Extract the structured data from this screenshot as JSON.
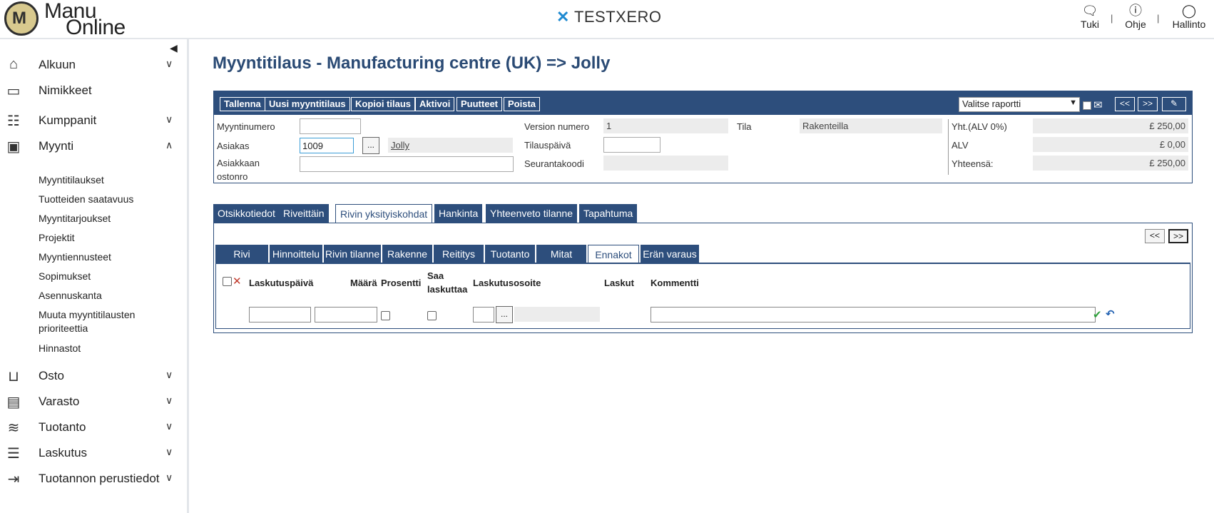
{
  "brand": {
    "line1": "Manu",
    "line2": "Online",
    "mark": "M"
  },
  "company": {
    "icon": "x-logo-icon",
    "name": "TESTXERO"
  },
  "topnav": [
    {
      "label": "Tuki",
      "icon": "chat-icon"
    },
    {
      "label": "Ohje",
      "icon": "help-icon"
    },
    {
      "label": "Hallinto",
      "icon": "user-icon"
    }
  ],
  "topnav_sep": "|",
  "sidebar": {
    "items": [
      {
        "label": "Alkuun",
        "icon": "home-icon",
        "expand": "down"
      },
      {
        "label": "Nimikkeet",
        "icon": "inbox-icon",
        "expand": ""
      },
      {
        "label": "Kumppanit",
        "icon": "contacts-icon",
        "expand": "down"
      },
      {
        "label": "Myynti",
        "icon": "wallet-icon",
        "expand": "up"
      },
      {
        "label": "Osto",
        "icon": "basket-icon",
        "expand": "down"
      },
      {
        "label": "Varasto",
        "icon": "warehouse-icon",
        "expand": "down"
      },
      {
        "label": "Tuotanto",
        "icon": "database-icon",
        "expand": "down"
      },
      {
        "label": "Laskutus",
        "icon": "document-icon",
        "expand": "down"
      },
      {
        "label": "Tuotannon perustiedot",
        "icon": "signout-icon",
        "expand": "down"
      }
    ],
    "myynti_sub": [
      "Myyntitilaukset",
      "Tuotteiden saatavuus",
      "Myyntitarjoukset",
      "Projektit",
      "Myyntiennusteet",
      "Sopimukset",
      "Asennuskanta",
      "Muuta myyntitilausten prioriteettia",
      "Hinnastot"
    ]
  },
  "page": {
    "title": "Myyntitilaus - Manufacturing centre (UK) => Jolly"
  },
  "toolbar": {
    "buttons": [
      "Tallenna",
      "Uusi myyntitilaus",
      "Kopioi tilaus",
      "Aktivoi",
      "Puutteet",
      "Poista"
    ],
    "report_select": "Valitse raportti",
    "prev": "<<",
    "next": ">>"
  },
  "header": {
    "myyntinumero_label": "Myyntinumero",
    "myyntinumero_value": "",
    "asiakas_label": "Asiakas",
    "asiakas_value": "1009",
    "asiakas_name": "Jolly",
    "ostonro_label1": "Asiakkaan",
    "ostonro_label2": "ostonro",
    "ostonro_value": "",
    "version_label": "Version numero",
    "version_value": "1",
    "tilauspaiva_label": "Tilauspäivä",
    "tilauspaiva_value": "",
    "seurantakoodi_label": "Seurantakoodi",
    "seurantakoodi_value": "",
    "tila_label": "Tila",
    "tila_value": "Rakenteilla",
    "yht_label": "Yht.(ALV 0%)",
    "yht_value": "£ 250,00",
    "alv_label": "ALV",
    "alv_value": "£ 0,00",
    "total_label": "Yhteensä:",
    "total_value": "£ 250,00",
    "dots": "..."
  },
  "tabs": [
    "Otsikkotiedot",
    "Riveittäin",
    "Rivin yksityiskohdat",
    "Hankinta",
    "Yhteenveto tilanne",
    "Tapahtuma"
  ],
  "active_tab": "Rivin yksityiskohdat",
  "panel": {
    "prev": "<<",
    "next": ">>",
    "subtabs": [
      "Rivi",
      "Hinnoittelu",
      "Rivin tilanne",
      "Rakenne",
      "Reititys",
      "Tuotanto",
      "Mitat",
      "Ennakot",
      "Erän varaus"
    ],
    "active_subtab": "Ennakot",
    "columns": {
      "laskutuspaiva": "Laskutuspäivä",
      "maara": "Määrä",
      "prosentti": "Prosentti",
      "saa_laskuttaa_1": "Saa",
      "saa_laskuttaa_2": "laskuttaa",
      "laskutusosoite": "Laskutusosoite",
      "laskut": "Laskut",
      "kommentti": "Kommentti"
    },
    "dots": "..."
  },
  "colors": {
    "accent": "#2d4e7c",
    "title": "#2a4a74",
    "brand_blue": "#1f8ad1",
    "delete_red": "#c0392b",
    "confirm_green": "#2e9e3b"
  }
}
